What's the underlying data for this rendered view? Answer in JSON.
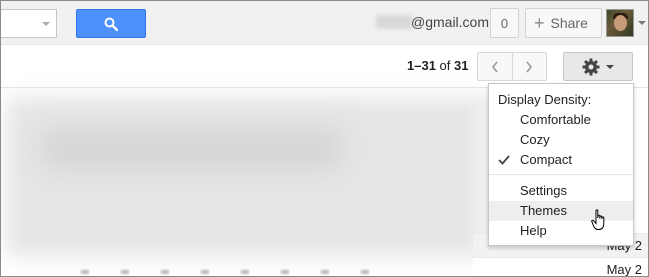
{
  "header": {
    "email_suffix": "@gmail.com",
    "notification_count": "0",
    "share_label": "Share"
  },
  "toolbar": {
    "pagination": {
      "range": "1–31",
      "of": "of",
      "total": "31"
    }
  },
  "settings_menu": {
    "density_header": "Display Density:",
    "density_options": [
      {
        "label": "Comfortable",
        "checked": false
      },
      {
        "label": "Cozy",
        "checked": false
      },
      {
        "label": "Compact",
        "checked": true
      }
    ],
    "items": [
      {
        "label": "Settings"
      },
      {
        "label": "Themes",
        "hovered": true
      },
      {
        "label": "Help"
      }
    ]
  },
  "messages": {
    "dates": [
      "May 2",
      "May 2"
    ]
  },
  "colors": {
    "search_button": "#4d90fe",
    "menu_hover": "#eeeeee"
  }
}
